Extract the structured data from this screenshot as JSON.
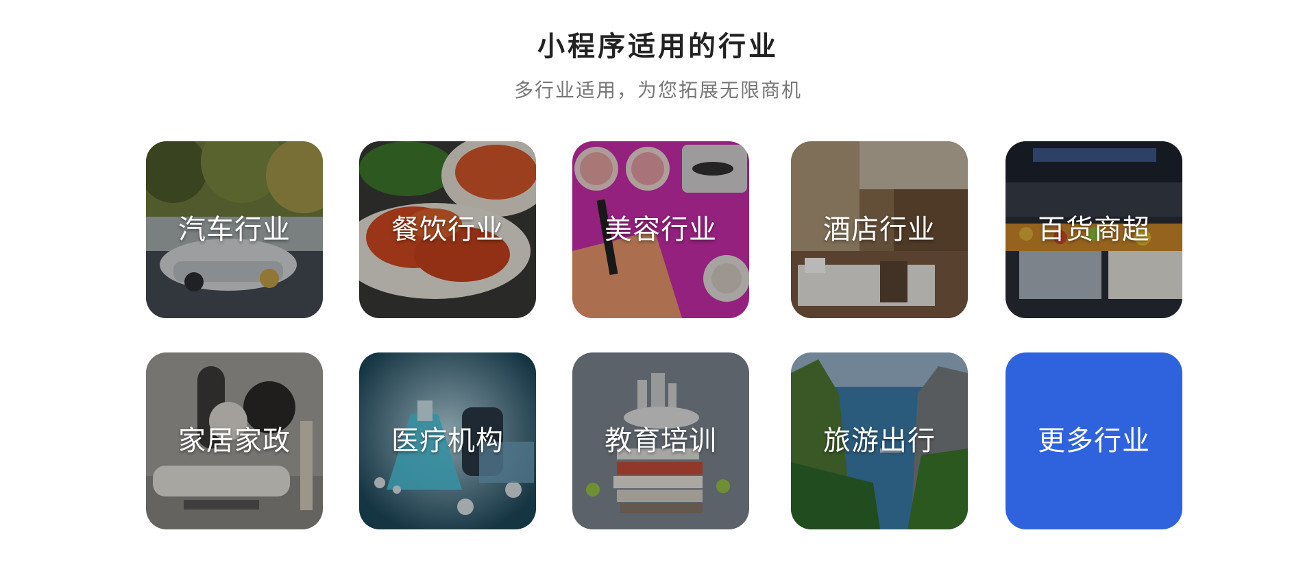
{
  "header": {
    "title": "小程序适用的行业",
    "subtitle": "多行业适用，为您拓展无限商机"
  },
  "industries": [
    {
      "label": "汽车行业",
      "icon": "car-image"
    },
    {
      "label": "餐饮行业",
      "icon": "food-image"
    },
    {
      "label": "美容行业",
      "icon": "cosmetics-image"
    },
    {
      "label": "酒店行业",
      "icon": "hotel-image"
    },
    {
      "label": "百货商超",
      "icon": "supermarket-image"
    },
    {
      "label": "家居家政",
      "icon": "home-image"
    },
    {
      "label": "医疗机构",
      "icon": "medical-image"
    },
    {
      "label": "教育培训",
      "icon": "education-image"
    },
    {
      "label": "旅游出行",
      "icon": "travel-image"
    },
    {
      "label": "更多行业",
      "icon": "more-industries"
    }
  ],
  "colors": {
    "more_button_bg": "#2f63dd",
    "title": "#222222",
    "subtitle": "#777777"
  }
}
